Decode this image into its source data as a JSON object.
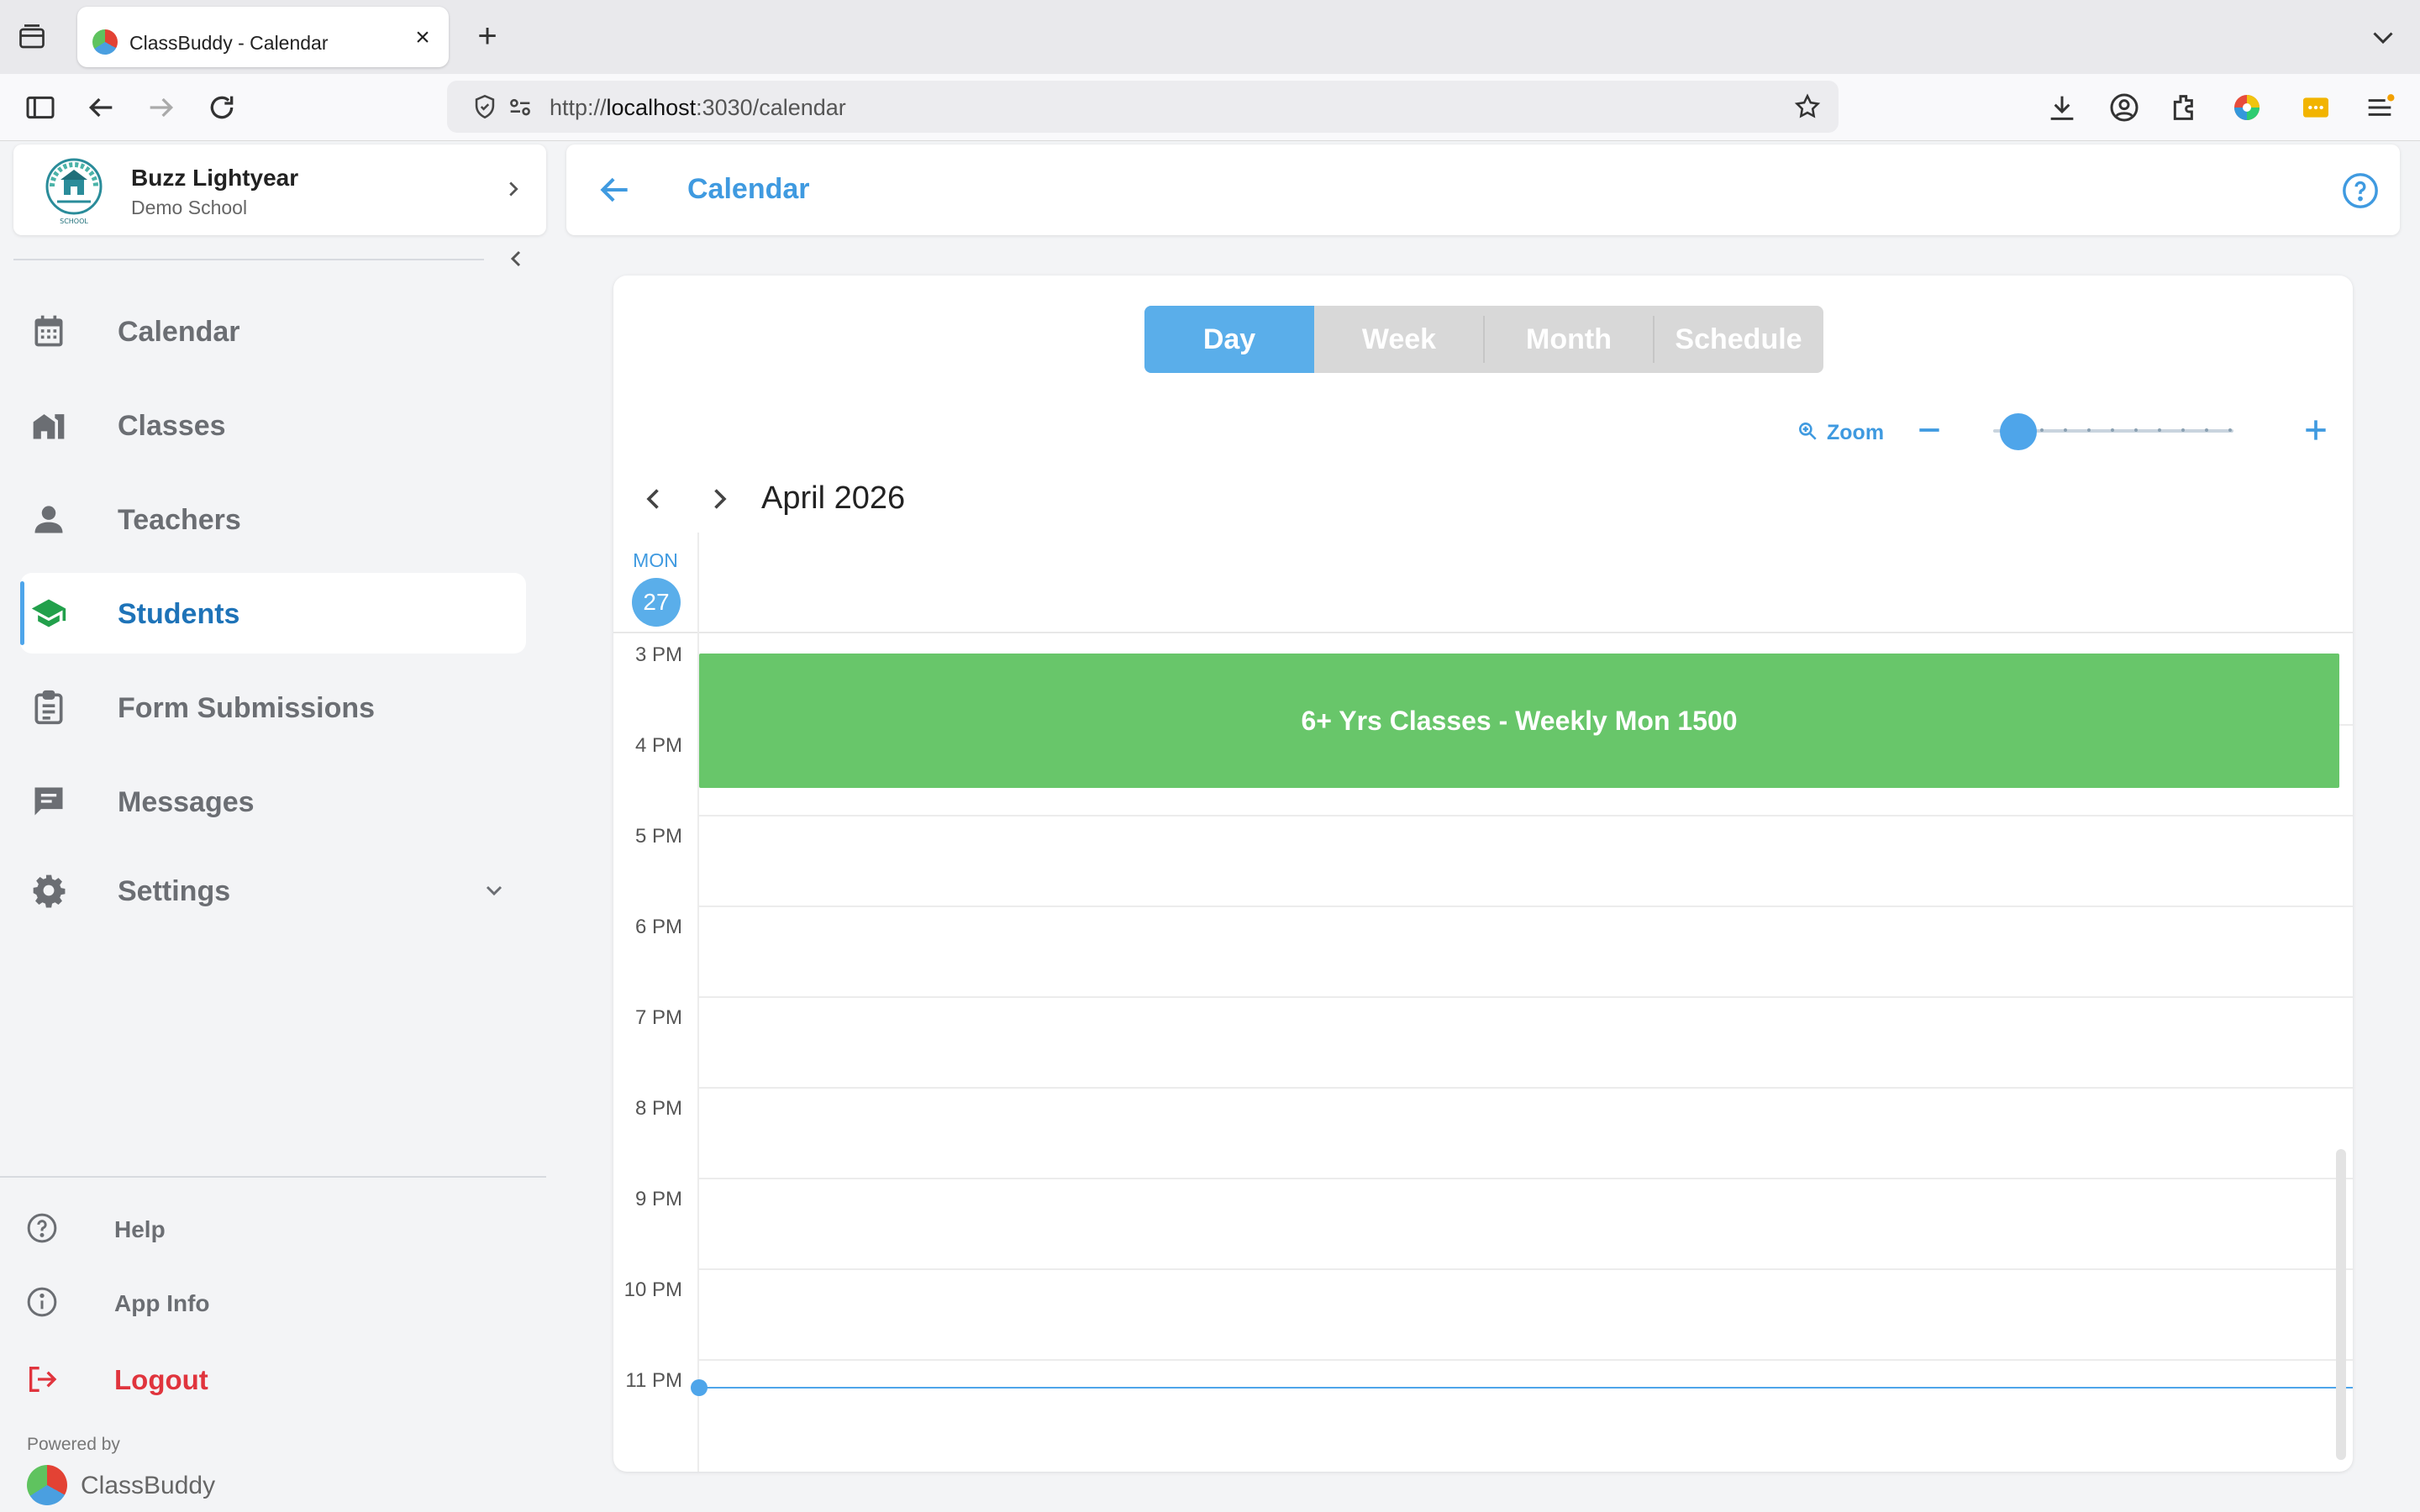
{
  "browser": {
    "tab_title": "ClassBuddy - Calendar",
    "url_prefix": "http://",
    "url_host": "localhost",
    "url_rest": ":3030/calendar"
  },
  "profile": {
    "name": "Buzz Lightyear",
    "school": "Demo School"
  },
  "sidebar": {
    "items": [
      {
        "label": "Calendar",
        "icon": "calendar-icon"
      },
      {
        "label": "Classes",
        "icon": "classes-icon"
      },
      {
        "label": "Teachers",
        "icon": "person-icon"
      },
      {
        "label": "Students",
        "icon": "graduation-cap-icon",
        "active": true
      },
      {
        "label": "Form Submissions",
        "icon": "clipboard-icon"
      },
      {
        "label": "Messages",
        "icon": "message-icon"
      },
      {
        "label": "Settings",
        "icon": "gear-icon"
      }
    ],
    "bottom": {
      "help": "Help",
      "app_info": "App Info",
      "logout": "Logout"
    },
    "powered_by": "Powered by",
    "brand": "ClassBuddy"
  },
  "header": {
    "title": "Calendar"
  },
  "calendar": {
    "views": [
      "Day",
      "Week",
      "Month",
      "Schedule"
    ],
    "active_view": "Day",
    "zoom_label": "Zoom",
    "zoom_level": 0,
    "month_label": "April 2026",
    "day_of_week": "MON",
    "day_number": "27",
    "hours": [
      "3 PM",
      "4 PM",
      "5 PM",
      "6 PM",
      "7 PM",
      "8 PM",
      "9 PM",
      "10 PM",
      "11 PM"
    ],
    "event": {
      "title": "6+ Yrs Classes - Weekly Mon 1500"
    }
  },
  "colors": {
    "accent": "#4ea5ea",
    "event": "#68c66a",
    "logout": "#e0343d"
  }
}
